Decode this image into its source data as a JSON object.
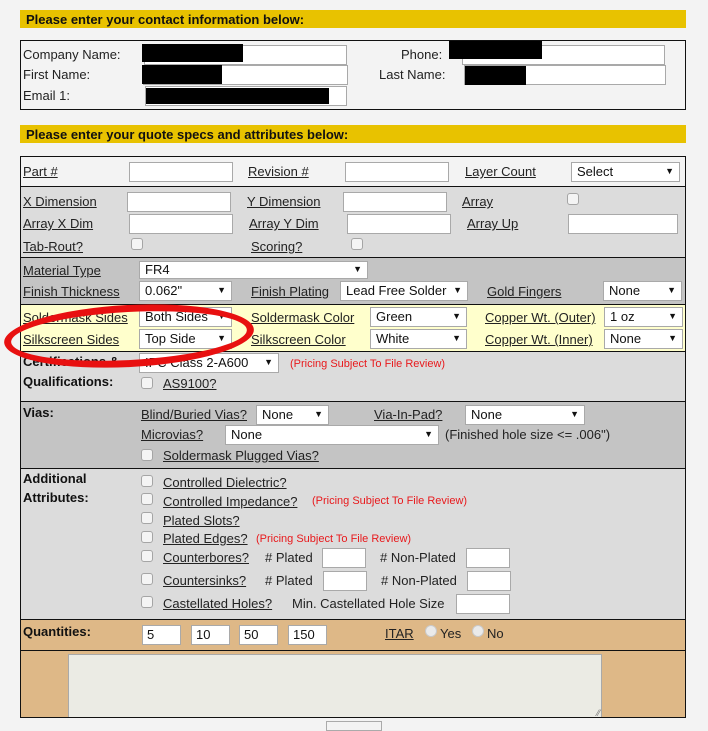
{
  "contact": {
    "banner": "Please enter your contact information below:",
    "company_label": "Company Name:",
    "first_label": "First Name:",
    "email_label": "Email 1:",
    "phone_label": "Phone:",
    "last_label": "Last Name:"
  },
  "specs": {
    "banner": "Please enter your quote specs and attributes below:",
    "part_label": "Part #",
    "revision_label": "Revision #",
    "layer_count_label": "Layer Count",
    "layer_count_value": "Select",
    "x_dim_label": "X Dimension",
    "y_dim_label": "Y Dimension",
    "array_label": "Array",
    "array_x_label": "Array X Dim",
    "array_y_label": "Array Y Dim",
    "array_up_label": "Array Up",
    "tab_rout_label": "Tab-Rout?",
    "scoring_label": "Scoring?",
    "material_label": "Material Type",
    "material_value": "FR4",
    "finish_thickness_label": "Finish Thickness",
    "finish_thickness_value": "0.062\"",
    "finish_plating_label": "Finish Plating",
    "finish_plating_value": "Lead Free Solder",
    "gold_fingers_label": "Gold Fingers",
    "gold_fingers_value": "None",
    "soldermask_sides_label": "Soldermask Sides",
    "soldermask_sides_value": "Both Sides",
    "soldermask_color_label": "Soldermask Color",
    "soldermask_color_value": "Green",
    "copper_outer_label": "Copper Wt. (Outer)",
    "copper_outer_value": "1 oz",
    "silkscreen_sides_label": "Silkscreen Sides",
    "silkscreen_sides_value": "Top Side",
    "silkscreen_color_label": "Silkscreen Color",
    "silkscreen_color_value": "White",
    "copper_inner_label": "Copper Wt. (Inner)",
    "copper_inner_value": "None",
    "cert_label_1": "Certifications &",
    "cert_label_2": "Qualifications:",
    "cert_value": "IPC Class 2-A600",
    "pricing_note": "(Pricing Subject To File Review)",
    "as9100_label": "AS9100?",
    "vias_label": "Vias:",
    "blind_label": "Blind/Buried Vias?",
    "blind_value": "None",
    "via_in_pad_label": "Via-In-Pad?",
    "via_in_pad_value": "None",
    "microvias_label": "Microvias?",
    "microvias_value": "None",
    "microvias_note": "(Finished hole size <= .006\")",
    "plugged_label": "Soldermask Plugged Vias?",
    "additional_label_1": "Additional",
    "additional_label_2": "Attributes:",
    "controlled_dielectric": "Controlled Dielectric?",
    "controlled_impedance": "Controlled Impedance?",
    "plated_slots": "Plated Slots?",
    "plated_edges": "Plated Edges?",
    "counterbores": "Counterbores?",
    "countersinks": "Countersinks?",
    "castellated": "Castellated Holes?",
    "plated_count_label": "# Plated",
    "nonplated_count_label": "# Non-Plated",
    "min_castellated_label": "Min. Castellated Hole Size",
    "quantities_label": "Quantities:",
    "quantities": [
      "5",
      "10",
      "50",
      "150"
    ],
    "itar_label": "ITAR",
    "itar_yes": "Yes",
    "itar_no": "No"
  }
}
